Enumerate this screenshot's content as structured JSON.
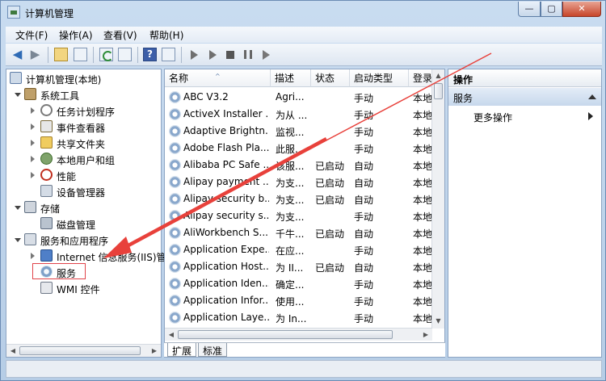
{
  "window": {
    "title": "计算机管理(本地)",
    "app_title": "计算机管理",
    "controls": {
      "min": "—",
      "max": "▢",
      "close": "✕"
    }
  },
  "menu": [
    "文件(F)",
    "操作(A)",
    "查看(V)",
    "帮助(H)"
  ],
  "tree": {
    "root": "计算机管理(本地)",
    "system_tools": "系统工具",
    "items": {
      "task_scheduler": "任务计划程序",
      "event_viewer": "事件查看器",
      "shared_folders": "共享文件夹",
      "local_users": "本地用户和组",
      "performance": "性能",
      "device_manager": "设备管理器"
    },
    "storage": "存储",
    "disk_mgmt": "磁盘管理",
    "services_apps": "服务和应用程序",
    "iis": "Internet 信息服务(IIS)管",
    "services": "服务",
    "wmi": "WMI 控件"
  },
  "columns": {
    "name": "名称",
    "desc": "描述",
    "status": "状态",
    "startup": "启动类型",
    "logon": "登录"
  },
  "services": [
    {
      "name": "ABC V3.2",
      "desc": "Agri...",
      "status": "",
      "startup": "手动",
      "logon": "本地"
    },
    {
      "name": "ActiveX Installer ...",
      "desc": "为从 ...",
      "status": "",
      "startup": "手动",
      "logon": "本地"
    },
    {
      "name": "Adaptive Brightn...",
      "desc": "监视...",
      "status": "",
      "startup": "手动",
      "logon": "本地"
    },
    {
      "name": "Adobe Flash Pla...",
      "desc": "此服...",
      "status": "",
      "startup": "手动",
      "logon": "本地"
    },
    {
      "name": "Alibaba PC Safe ...",
      "desc": "该服...",
      "status": "已启动",
      "startup": "自动",
      "logon": "本地"
    },
    {
      "name": "Alipay payment ...",
      "desc": "为支...",
      "status": "已启动",
      "startup": "自动",
      "logon": "本地"
    },
    {
      "name": "Alipay security b...",
      "desc": "为支...",
      "status": "已启动",
      "startup": "自动",
      "logon": "本地"
    },
    {
      "name": "Alipay security s...",
      "desc": "为支...",
      "status": "",
      "startup": "手动",
      "logon": "本地"
    },
    {
      "name": "AliWorkbench S...",
      "desc": "千牛...",
      "status": "已启动",
      "startup": "自动",
      "logon": "本地"
    },
    {
      "name": "Application Expe...",
      "desc": "在应...",
      "status": "",
      "startup": "手动",
      "logon": "本地"
    },
    {
      "name": "Application Host...",
      "desc": "为 II...",
      "status": "已启动",
      "startup": "自动",
      "logon": "本地"
    },
    {
      "name": "Application Iden...",
      "desc": "确定...",
      "status": "",
      "startup": "手动",
      "logon": "本地"
    },
    {
      "name": "Application Infor...",
      "desc": "使用...",
      "status": "",
      "startup": "手动",
      "logon": "本地"
    },
    {
      "name": "Application Laye...",
      "desc": "为 In...",
      "status": "",
      "startup": "手动",
      "logon": "本地"
    }
  ],
  "tabs": {
    "extended": "扩展",
    "standard": "标准"
  },
  "actions": {
    "header": "操作",
    "section": "服务",
    "more": "更多操作"
  },
  "colors": {
    "annotation": "#e8413b",
    "selection_border": "#e0434a"
  }
}
